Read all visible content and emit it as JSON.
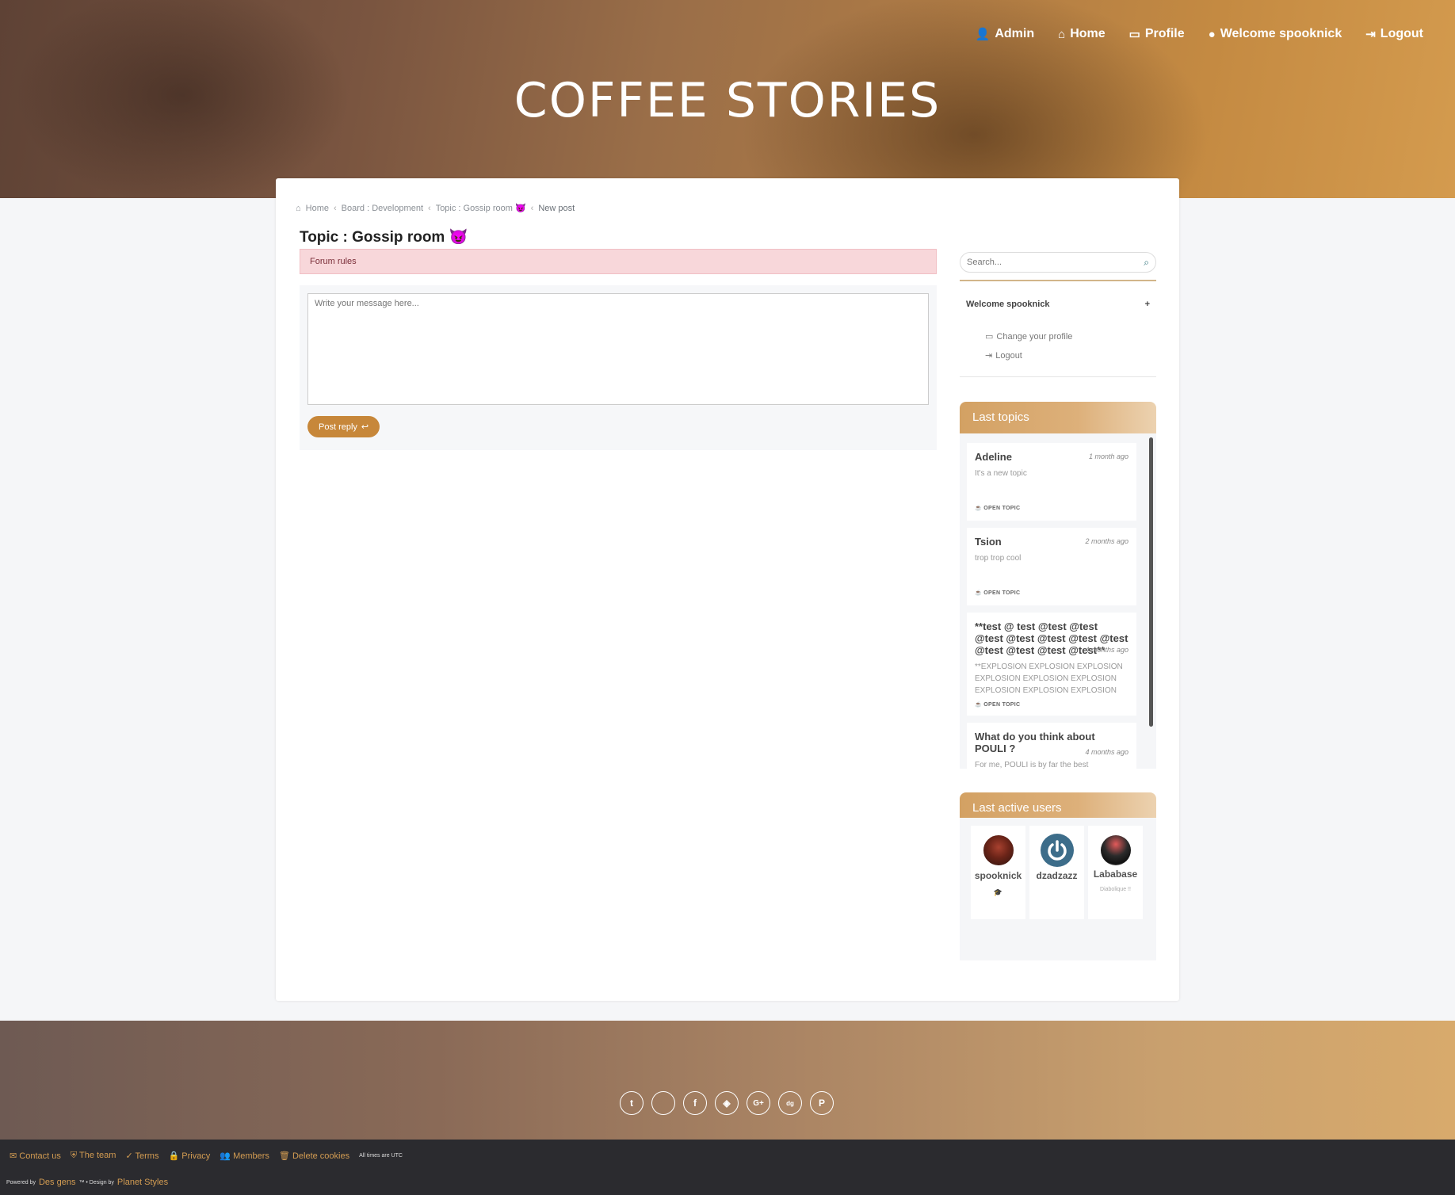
{
  "nav": {
    "admin": "Admin",
    "home": "Home",
    "profile": "Profile",
    "welcome": "Welcome spooknick",
    "logout": "Logout"
  },
  "site_title": "COFFEE STORIES",
  "breadcrumb": {
    "home": "Home",
    "board": "Board : Development",
    "topic": "Topic : Gossip room 😈",
    "current": "New post"
  },
  "topic_title": "Topic : Gossip room 😈",
  "forum_rules": "Forum rules",
  "editor": {
    "placeholder": "Write your message here..."
  },
  "post_reply": "Post reply",
  "search": {
    "placeholder": "Search..."
  },
  "sidebar": {
    "welcome": "Welcome spooknick",
    "toggle": "+",
    "change_profile": "Change your profile",
    "logout": "Logout"
  },
  "last_topics": {
    "title": "Last topics",
    "items": [
      {
        "title": "Adeline",
        "time": "1 month ago",
        "excerpt": "It's a new topic",
        "badge": "OPEN TOPIC"
      },
      {
        "title": "Tsion",
        "time": "2 months ago",
        "excerpt": "trop trop cool",
        "badge": "OPEN TOPIC"
      },
      {
        "title": "**test @ test @test @test @test @test @test @test @test @test @test @test @test**",
        "time": "4 months ago",
        "excerpt": "**EXPLOSION EXPLOSION EXPLOSION EXPLOSION EXPLOSION EXPLOSION EXPLOSION EXPLOSION EXPLOSION",
        "badge": "OPEN TOPIC"
      },
      {
        "title": "What do you think about POULI ?",
        "time": "4 months ago",
        "excerpt": "For me, POULI is by far the best"
      }
    ]
  },
  "last_users": {
    "title": "Last active users",
    "items": [
      {
        "name": "spooknick",
        "tag": "🎓"
      },
      {
        "name": "dzadzazz",
        "tag": ""
      },
      {
        "name": "Lababase",
        "tag": "Diabolique !!"
      }
    ]
  },
  "footer": {
    "socials": [
      "twitter-icon",
      "apple-icon",
      "facebook-icon",
      "codepen-icon",
      "google-plus-icon",
      "digg-icon",
      "pinterest-icon"
    ],
    "links": {
      "contact": "Contact us",
      "team": "The team",
      "terms": "Terms",
      "privacy": "Privacy",
      "members": "Members",
      "cookies": "Delete cookies",
      "utc": "All times are UTC"
    },
    "powered_by": "Powered by",
    "des_gens": "Des gens",
    "design_by": "™ • Design by",
    "planet_styles": "Planet Styles"
  },
  "colors": {
    "accent": "#c7873a",
    "rules_bg": "#f8d7da",
    "footer_dark": "#2b2b2f",
    "link": "#d39c52"
  }
}
